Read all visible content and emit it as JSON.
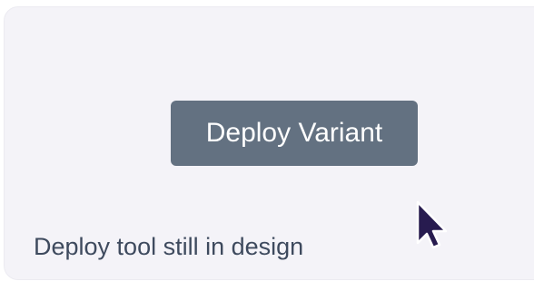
{
  "button": {
    "label": "Deploy Variant",
    "background": "#637181",
    "text_color": "#ffffff"
  },
  "status": {
    "text": "Deploy tool still in design",
    "color": "#3e4a5e"
  },
  "cursor": {
    "icon": "mouse-pointer-icon",
    "color": "#271b4f"
  },
  "card": {
    "background": "#f4f3f8"
  }
}
